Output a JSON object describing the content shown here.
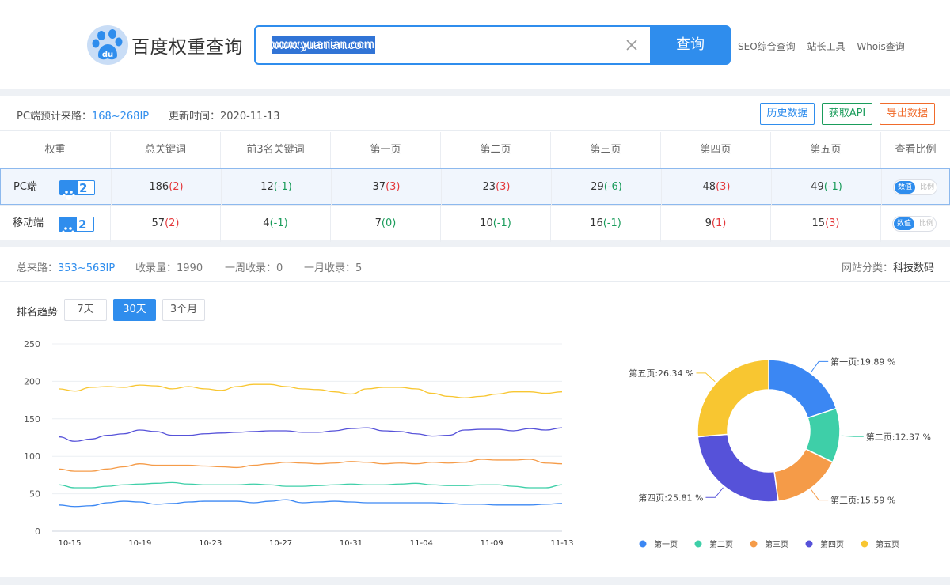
{
  "header": {
    "site_title": "百度权重查询",
    "search_value": "www.yuanian.com",
    "search_button": "查询",
    "links": [
      "SEO综合查询",
      "站长工具",
      "Whois查询"
    ]
  },
  "weight_panel": {
    "pc_source_label": "PC端预计来路：",
    "pc_source_value": "168~268IP",
    "update_label": "更新时间：",
    "update_value": "2020-11-13",
    "buttons": {
      "history": "历史数据",
      "api": "获取API",
      "export": "导出数据"
    },
    "columns": [
      "权重",
      "总关键词",
      "前3名关键词",
      "第一页",
      "第二页",
      "第三页",
      "第四页",
      "第五页",
      "查看比例"
    ],
    "rows": [
      {
        "label": "PC端",
        "weight": "2",
        "cells": [
          {
            "v": "186",
            "d": "(2)",
            "c": "red"
          },
          {
            "v": "12",
            "d": "(-1)",
            "c": "green"
          },
          {
            "v": "37",
            "d": "(3)",
            "c": "red"
          },
          {
            "v": "23",
            "d": "(3)",
            "c": "red"
          },
          {
            "v": "29",
            "d": "(-6)",
            "c": "green"
          },
          {
            "v": "48",
            "d": "(3)",
            "c": "red"
          },
          {
            "v": "49",
            "d": "(-1)",
            "c": "green"
          }
        ]
      },
      {
        "label": "移动端",
        "weight": "2",
        "cells": [
          {
            "v": "57",
            "d": "(2)",
            "c": "red"
          },
          {
            "v": "4",
            "d": "(-1)",
            "c": "green"
          },
          {
            "v": "7",
            "d": "(0)",
            "c": "green"
          },
          {
            "v": "10",
            "d": "(-1)",
            "c": "green"
          },
          {
            "v": "16",
            "d": "(-1)",
            "c": "green"
          },
          {
            "v": "9",
            "d": "(1)",
            "c": "red"
          },
          {
            "v": "15",
            "d": "(3)",
            "c": "red"
          }
        ]
      }
    ],
    "toggle": {
      "on": "数值",
      "off": "比例"
    }
  },
  "trend_panel": {
    "total_label": "总来路：",
    "total_value": "353~563IP",
    "indexed_label": "收录量：",
    "indexed_value": "1990",
    "week_label": "一周收录：",
    "week_value": "0",
    "month_label": "一月收录：",
    "month_value": "5",
    "category_label": "网站分类：",
    "category_value": "科技数码",
    "trend_label": "排名趋势",
    "ranges": [
      "7天",
      "30天",
      "3个月"
    ],
    "active_range": "30天"
  },
  "chart_data": [
    {
      "type": "line",
      "ylim": [
        0,
        250
      ],
      "yticks": [
        0,
        50,
        100,
        150,
        200,
        250
      ],
      "xtick_labels": [
        "10-15",
        "10-19",
        "10-23",
        "10-27",
        "10-31",
        "11-04",
        "11-09",
        "11-13"
      ],
      "grid": true,
      "series": [
        {
          "color": "#3b87f3",
          "values": [
            35,
            33,
            34,
            38,
            40,
            39,
            36,
            37,
            39,
            40,
            40,
            40,
            38,
            40,
            42,
            38,
            39,
            40,
            39,
            38,
            38,
            38,
            38,
            38,
            37,
            36,
            36,
            35,
            35,
            35,
            36,
            37
          ]
        },
        {
          "color": "#3ecfa8",
          "values": [
            62,
            58,
            58,
            60,
            62,
            63,
            64,
            65,
            63,
            62,
            62,
            62,
            63,
            62,
            60,
            60,
            61,
            62,
            63,
            62,
            62,
            63,
            64,
            62,
            61,
            61,
            62,
            62,
            60,
            58,
            58,
            62
          ]
        },
        {
          "color": "#f59b48",
          "values": [
            83,
            80,
            80,
            83,
            86,
            90,
            88,
            88,
            88,
            87,
            86,
            85,
            88,
            90,
            92,
            91,
            90,
            91,
            93,
            92,
            90,
            91,
            90,
            92,
            91,
            92,
            96,
            95,
            95,
            96,
            91,
            90
          ]
        },
        {
          "color": "#5652d9",
          "values": [
            126,
            120,
            123,
            128,
            130,
            135,
            133,
            128,
            128,
            130,
            131,
            132,
            133,
            134,
            134,
            132,
            132,
            134,
            137,
            138,
            134,
            133,
            130,
            127,
            128,
            135,
            136,
            136,
            134,
            137,
            135,
            138
          ]
        },
        {
          "color": "#f8c631",
          "values": [
            190,
            187,
            192,
            193,
            192,
            195,
            194,
            190,
            193,
            190,
            188,
            193,
            196,
            196,
            193,
            190,
            189,
            186,
            183,
            190,
            192,
            192,
            190,
            184,
            180,
            178,
            180,
            183,
            186,
            186,
            184,
            186
          ]
        }
      ]
    },
    {
      "type": "pie",
      "donut": true,
      "labels": [
        "第一页",
        "第二页",
        "第三页",
        "第四页",
        "第五页"
      ],
      "values": [
        19.89,
        12.37,
        15.59,
        25.81,
        26.34
      ],
      "colors": [
        "#3b87f3",
        "#3ecfa8",
        "#f59b48",
        "#5652d9",
        "#f8c631"
      ],
      "data_labels": [
        "第一页:19.89 %",
        "第二页:12.37 %",
        "第三页:15.59 %",
        "第四页:25.81 %",
        "第五页:26.34 %"
      ],
      "legend_position": "bottom"
    }
  ]
}
